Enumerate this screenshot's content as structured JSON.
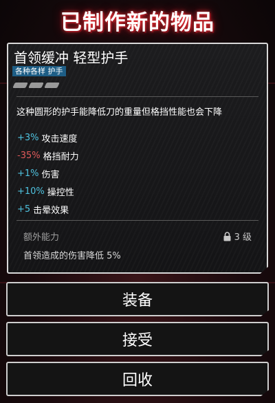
{
  "header": {
    "title": "已制作新的物品"
  },
  "item": {
    "name": "首领缓冲 轻型护手",
    "tag": "各种各样 护手",
    "description": "这种圆形的护手能降低刀的重量但格挡性能也会下降",
    "stats": [
      {
        "value": "+3%",
        "label": "攻击速度",
        "color": "#4fc3e0"
      },
      {
        "value": "-35%",
        "label": "格挡耐力",
        "color": "#e05a5a"
      },
      {
        "value": "+1%",
        "label": "伤害",
        "color": "#4fc3e0"
      },
      {
        "value": "+10%",
        "label": "操控性",
        "color": "#4fc3e0"
      },
      {
        "value": "+5",
        "label": "击晕效果",
        "color": "#4fc3e0"
      }
    ],
    "extra": {
      "title": "额外能力",
      "level": "3 级",
      "text": "首领造成的伤害降低 5%"
    }
  },
  "buttons": {
    "equip": "装备",
    "accept": "接受",
    "recycle": "回收"
  },
  "icons": {
    "lock": "lock-icon",
    "upgrade_pips": "upgrade-pip-icon"
  },
  "colors": {
    "positive": "#4fc3e0",
    "negative": "#e05a5a",
    "tag_bg": "#1e5e86",
    "title_glow": "#e0202e"
  }
}
